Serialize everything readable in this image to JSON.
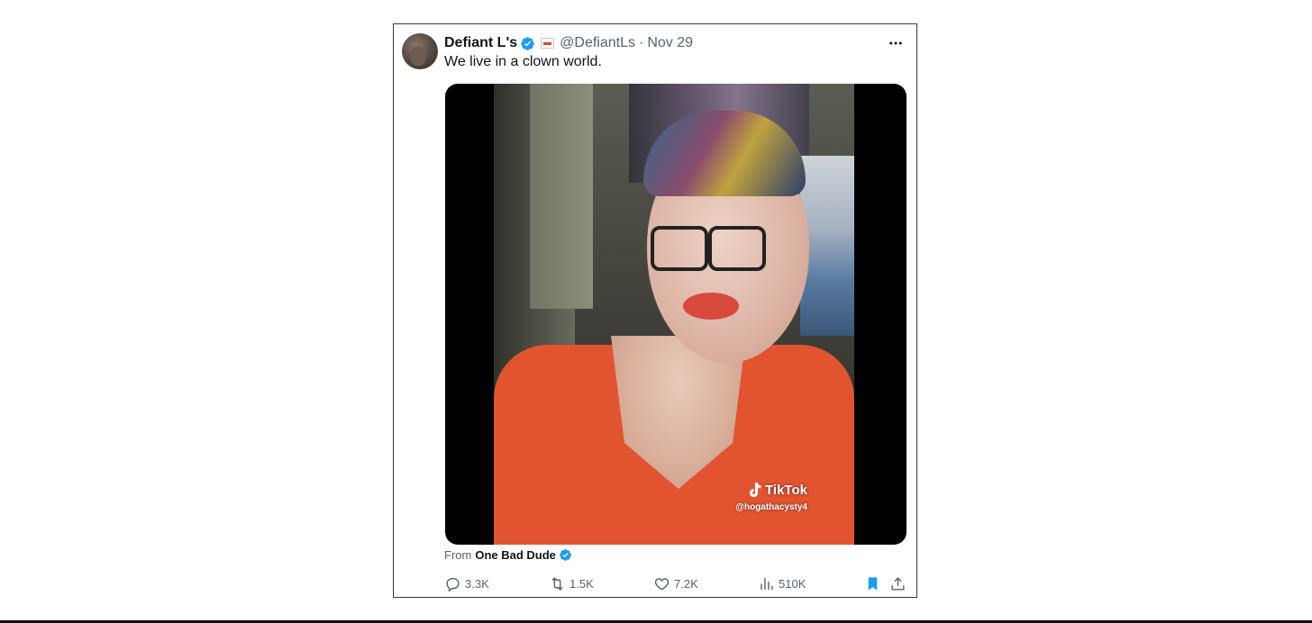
{
  "tweet": {
    "author_name": "Defiant L's",
    "handle": "@DefiantLs",
    "separator": "·",
    "date": "Nov 29",
    "text": "We live in a clown world.",
    "media": {
      "watermark_brand": "TikTok",
      "watermark_handle": "@hogathacysty4"
    },
    "source": {
      "prefix": "From",
      "name": "One Bad Dude"
    },
    "actions": {
      "replies": "3.3K",
      "retweets": "1.5K",
      "likes": "7.2K",
      "views": "510K"
    }
  },
  "icons": {
    "verified": "verified-badge-icon",
    "flag": "flag-icon",
    "more": "more-dots-icon",
    "reply": "reply-icon",
    "retweet": "retweet-icon",
    "like": "heart-icon",
    "views": "views-chart-icon",
    "bookmark": "bookmark-icon",
    "share": "share-icon"
  },
  "colors": {
    "verified_blue": "#1d9bf0",
    "muted_text": "#536471",
    "text": "#0f1419",
    "bookmark_active": "#1d9bf0"
  }
}
